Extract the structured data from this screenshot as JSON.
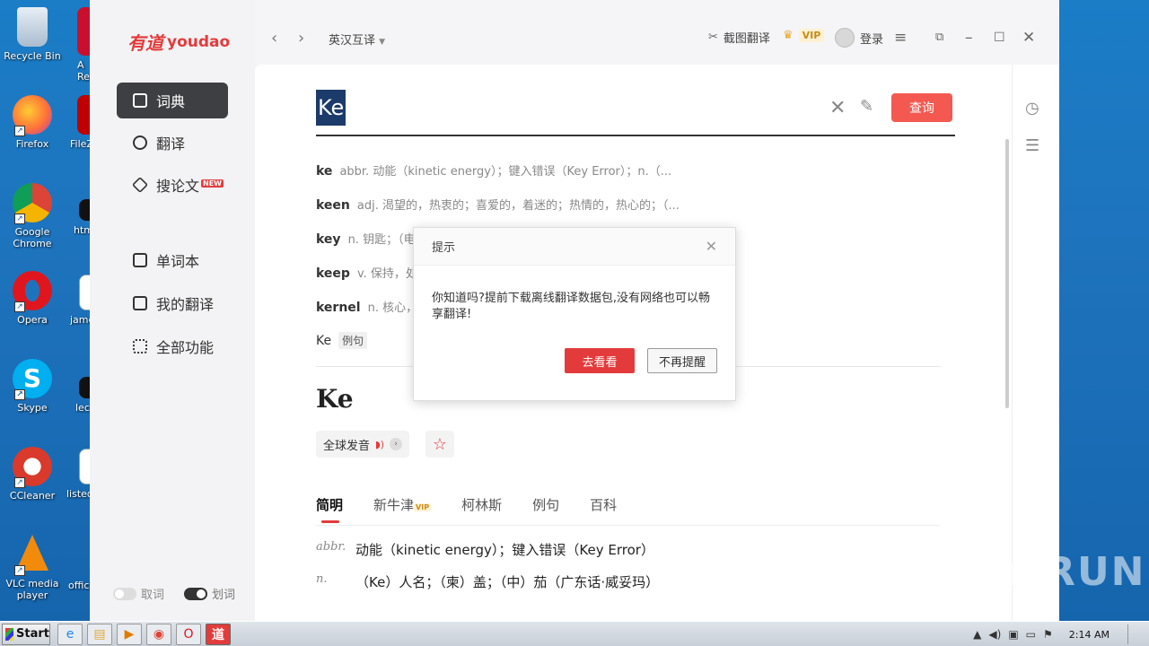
{
  "desktop": {
    "icons": [
      {
        "label": "Recycle Bin",
        "icon": "recycle-bin-icon",
        "color": "#c9d8e6"
      },
      {
        "label": "Firefox",
        "icon": "firefox-icon",
        "color": "#ff7139"
      },
      {
        "label": "Google Chrome",
        "icon": "chrome-icon",
        "color": "#4285f4"
      },
      {
        "label": "Opera",
        "icon": "opera-icon",
        "color": "#e0161e"
      },
      {
        "label": "Skype",
        "icon": "skype-icon",
        "color": "#00aff0"
      },
      {
        "label": "CCleaner",
        "icon": "ccleaner-icon",
        "color": "#d93a2b"
      },
      {
        "label": "VLC media player",
        "icon": "vlc-icon",
        "color": "#f28a0c"
      }
    ],
    "partial_icons": [
      "A Rea",
      "FileZ",
      "htm",
      "jame",
      "lec",
      "listed",
      "office"
    ]
  },
  "app": {
    "logo_cn": "有道",
    "logo_en": "youdao",
    "nav": [
      {
        "label": "词典",
        "active": true
      },
      {
        "label": "翻译",
        "active": false
      },
      {
        "label": "搜论文",
        "active": false,
        "badge": "NEW"
      },
      {
        "label": "单词本",
        "active": false
      },
      {
        "label": "我的翻译",
        "active": false
      },
      {
        "label": "全部功能",
        "active": false
      }
    ],
    "toggles": [
      {
        "label": "取词",
        "on": false
      },
      {
        "label": "划词",
        "on": true
      }
    ],
    "topbar": {
      "mode": "英汉互译",
      "screenshot_translate": "截图翻译",
      "vip": "VIP",
      "login": "登录"
    },
    "search": {
      "value": "Ke",
      "query_label": "查询"
    },
    "suggestions": [
      {
        "word": "ke",
        "def": "abbr. 动能（kinetic energy）；键入错误（Key Error）；n.（..."
      },
      {
        "word": "keen",
        "def": "adj. 渴望的，热衷的；喜爱的，着迷的；热情的，热心的；（..."
      },
      {
        "word": "key",
        "def": "n. 钥匙；（电"
      },
      {
        "word": "keep",
        "def": "v. 保持，处于"
      },
      {
        "word": "kernel",
        "def": "n. 核心，要"
      },
      {
        "word": "Ke",
        "tag": "例句"
      }
    ],
    "entry": {
      "headword": "Ke",
      "pronunciation_label": "全球发音",
      "tabs": [
        {
          "label": "简明",
          "active": true
        },
        {
          "label": "新牛津",
          "vip": "VIP"
        },
        {
          "label": "柯林斯"
        },
        {
          "label": "例句"
        },
        {
          "label": "百科"
        }
      ],
      "definitions": [
        {
          "pos": "abbr.",
          "text": "动能（kinetic energy）；键入错误（Key Error）"
        },
        {
          "pos": "n.",
          "text": "（Ke）人名；（柬）盖；（中）茄（广东话·威妥玛）"
        }
      ]
    },
    "dialog": {
      "title": "提示",
      "message": "你知道吗?提前下载离线翻译数据包,没有网络也可以畅享翻译!",
      "primary": "去看看",
      "secondary": "不再提醒"
    }
  },
  "watermark": "ANY RUN",
  "taskbar": {
    "start_label": "Start",
    "apps": [
      "ie-icon",
      "explorer-icon",
      "media-player-icon",
      "chrome-icon",
      "opera-icon",
      "youdao-icon"
    ],
    "clock": "2:14 AM"
  },
  "colors": {
    "accent": "#e33b3b",
    "query_button": "#f35950",
    "nav_active": "#3d3f43"
  }
}
